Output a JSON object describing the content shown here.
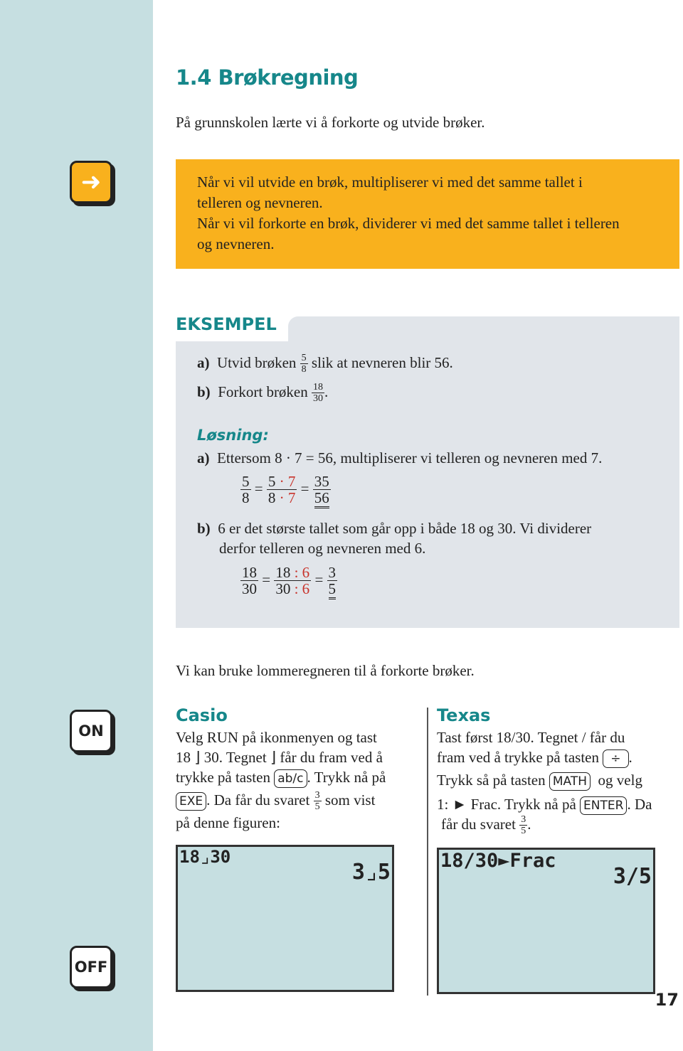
{
  "section_title": "1.4 Brøkregning",
  "intro": "På grunnskolen lærte vi å forkorte og utvide brøker.",
  "rule_box": {
    "icon": "arrow-right-icon",
    "lines": [
      "Når vi vil utvide en brøk, multipliserer vi med det samme tallet i",
      "telleren og nevneren.",
      "Når vi vil forkorte en brøk, dividerer vi med det samme tallet i telleren",
      "og nevneren."
    ]
  },
  "example": {
    "label": "EKSEMPEL",
    "a_label": "a)",
    "a_text1": "Utvid brøken",
    "a_frac": [
      "5",
      "8"
    ],
    "a_text2": "slik at nevneren blir 56.",
    "b_label": "b)",
    "b_text1": "Forkort brøken",
    "b_frac": [
      "18",
      "30"
    ],
    "b_text2": ".",
    "solution_label": "Løsning:",
    "sa_label": "a)",
    "sa_text": "Ettersom  8 · 7 = 56,  multipliserer vi telleren og nevneren med 7.",
    "sa_eq": {
      "f1": [
        "5",
        "8"
      ],
      "f2n": "5",
      "f2d": "8",
      "mult": "· 7",
      "f3": [
        "35",
        "56"
      ],
      "eq": "="
    },
    "sb_label": "b)",
    "sb_lines": [
      "6 er det største tallet som går opp i både 18 og 30. Vi dividerer",
      "derfor telleren og nevneren med 6."
    ],
    "sb_eq": {
      "f1": [
        "18",
        "30"
      ],
      "f2n": "18",
      "f2d": "30",
      "div": ": 6",
      "f3": [
        "3",
        "5"
      ],
      "eq": "="
    }
  },
  "calc_intro": "Vi kan bruke lommeregneren til å forkorte brøker.",
  "side_icons": {
    "on": "ON",
    "off": "OFF"
  },
  "casio": {
    "title": "Casio",
    "l1": "Velg  RUN  på ikonmenyen og tast",
    "l2": "18 ⌋ 30.  Tegnet  ⌋  får du fram ved å",
    "l3a": "trykke på tasten",
    "key1": "ab/c",
    "l3b": ". Trykk nå på",
    "key2": "EXE",
    "l4a": ". Da får du svaret",
    "frac": [
      "3",
      "5"
    ],
    "l4b": "som vist",
    "l5": "på denne figuren:",
    "screen": {
      "line1": "18⌟30",
      "line2": "3⌟5"
    }
  },
  "texas": {
    "title": "Texas",
    "l1": "Tast først  18/30.  Tegnet  /  får du",
    "l2a": "fram ved å trykke på tasten",
    "key1": "÷",
    "l2b": ".",
    "l3a": "Trykk så på tasten",
    "key2": "MATH",
    "l3b": "og velg",
    "l4a": "1: ► Frac.  Trykk nå på",
    "key3": "ENTER",
    "l4b": ".  Da",
    "l5a": "får du svaret",
    "frac": [
      "3",
      "5"
    ],
    "l5b": ".",
    "screen": {
      "line1": "18/30►Frac",
      "line2": "3/5"
    }
  },
  "page_number": "17",
  "colors": {
    "teal": "#16878a",
    "orange": "#f9b11d",
    "sidebar": "#c6dfe1",
    "example_bg": "#e1e5ea",
    "red": "#c8332b"
  }
}
